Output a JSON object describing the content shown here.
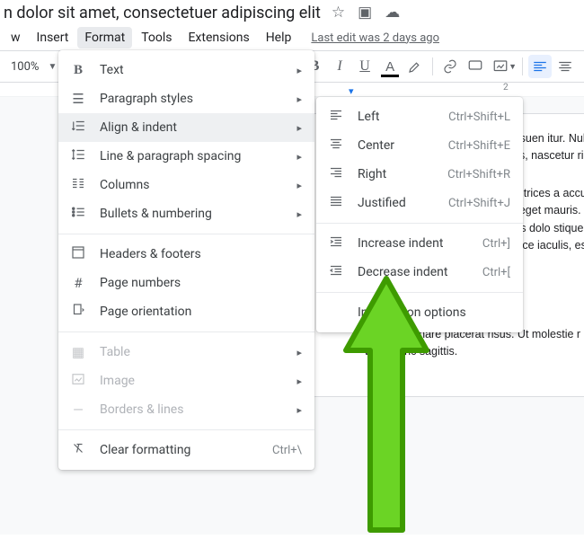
{
  "doc_title": "n dolor sit amet, consectetuer adipiscing elit",
  "menubar": {
    "items": [
      "w",
      "Insert",
      "Format",
      "Tools",
      "Extensions",
      "Help"
    ],
    "active_index": 2
  },
  "last_edit": "Last edit was 2 days ago",
  "toolbar": {
    "zoom": "100%"
  },
  "ruler": {
    "num1": "2"
  },
  "format_menu": {
    "items": [
      {
        "icon": "B",
        "label": "Text",
        "arrow": true
      },
      {
        "icon": "¶",
        "label": "Paragraph styles",
        "arrow": true
      },
      {
        "icon": "≡",
        "label": "Align & indent",
        "arrow": true,
        "highlight": true
      },
      {
        "icon": "‡≡",
        "label": "Line & paragraph spacing",
        "arrow": true
      },
      {
        "icon": "≣≣",
        "label": "Columns",
        "arrow": true
      },
      {
        "icon": "⋮≡",
        "label": "Bullets & numbering",
        "arrow": true
      }
    ],
    "items2": [
      {
        "icon": "▭",
        "label": "Headers & footers"
      },
      {
        "icon": "#",
        "label": "Page numbers"
      },
      {
        "icon": "⭱",
        "label": "Page orientation"
      }
    ],
    "items3": [
      {
        "icon": "▦",
        "label": "Table",
        "arrow": true,
        "disabled": true
      },
      {
        "icon": "▲",
        "label": "Image",
        "arrow": true,
        "disabled": true
      },
      {
        "icon": "—",
        "label": "Borders & lines",
        "arrow": true,
        "disabled": true
      }
    ],
    "items4": [
      {
        "icon": "✕",
        "label": "Clear formatting",
        "shortcut": "Ctrl+\\"
      }
    ]
  },
  "align_menu": {
    "items": [
      {
        "icon": "≡",
        "label": "Left",
        "shortcut": "Ctrl+Shift+L"
      },
      {
        "icon": "≡",
        "label": "Center",
        "shortcut": "Ctrl+Shift+E"
      },
      {
        "icon": "≡",
        "label": "Right",
        "shortcut": "Ctrl+Shift+R"
      },
      {
        "icon": "≡",
        "label": "Justified",
        "shortcut": "Ctrl+Shift+J"
      }
    ],
    "items2": [
      {
        "icon": "≡",
        "label": "Increase indent",
        "shortcut": "Ctrl+]"
      },
      {
        "icon": "≡",
        "label": "Decrease indent",
        "shortcut": "Ctrl+["
      }
    ],
    "items3": [
      {
        "icon": "",
        "label": "Indentation options"
      }
    ]
  },
  "paragraphs": [
    "que sene\ndin posuen\nitur. Nulla\n, tempus q\no, per ince\ncommodo\nit montes, nascetur ridiculus mus.\num at eros.",
    "ligula et tellus ullamcorper ultrices\na accumsan lacus, sed interdum wisi nil\nifend nulla eget mauris. Sed cursus quan\npibus dapibus nisl. Vestibulum quis dolo\nstique ac, tempus eget, egestas quis, mau\nusto. Fusce iaculis, est quis lacinia pretiun\nibero.",
    "Quisque ornare placerat risus. Ut molestie r\nmattis ligula posuere velit. Nunc sagittis."
  ]
}
